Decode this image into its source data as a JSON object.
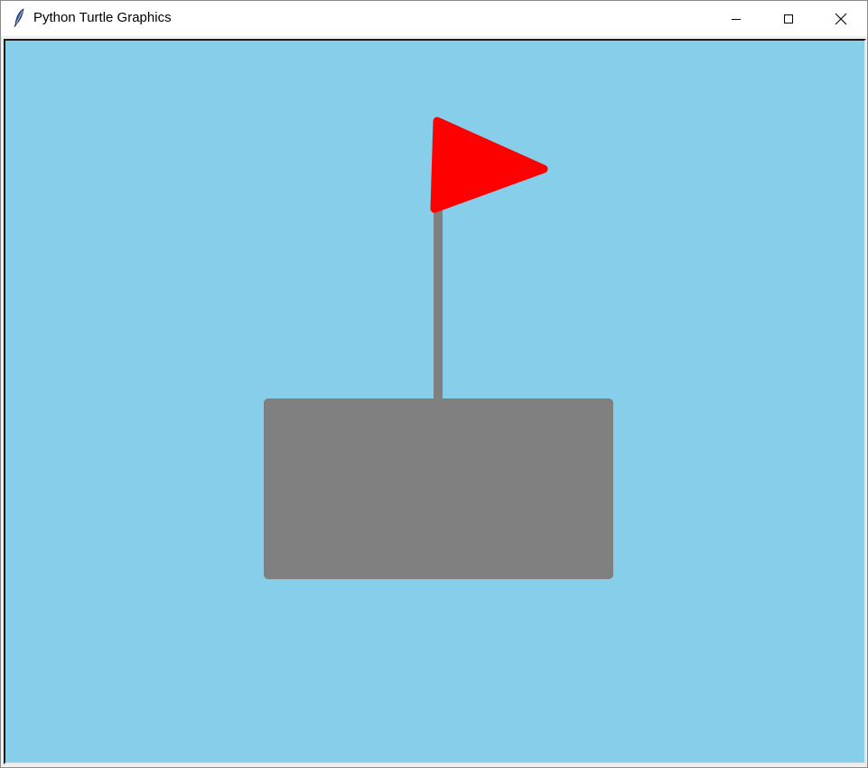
{
  "window": {
    "title": "Python Turtle Graphics",
    "icon": "feather-icon",
    "controls": {
      "minimize_icon": "minimize-icon",
      "maximize_icon": "maximize-icon",
      "close_icon": "close-icon"
    }
  },
  "canvas": {
    "background_color": "#87CEEB",
    "shapes": {
      "base_color": "#808080",
      "pole_color": "#808080",
      "flag_color": "#FF0000"
    }
  }
}
